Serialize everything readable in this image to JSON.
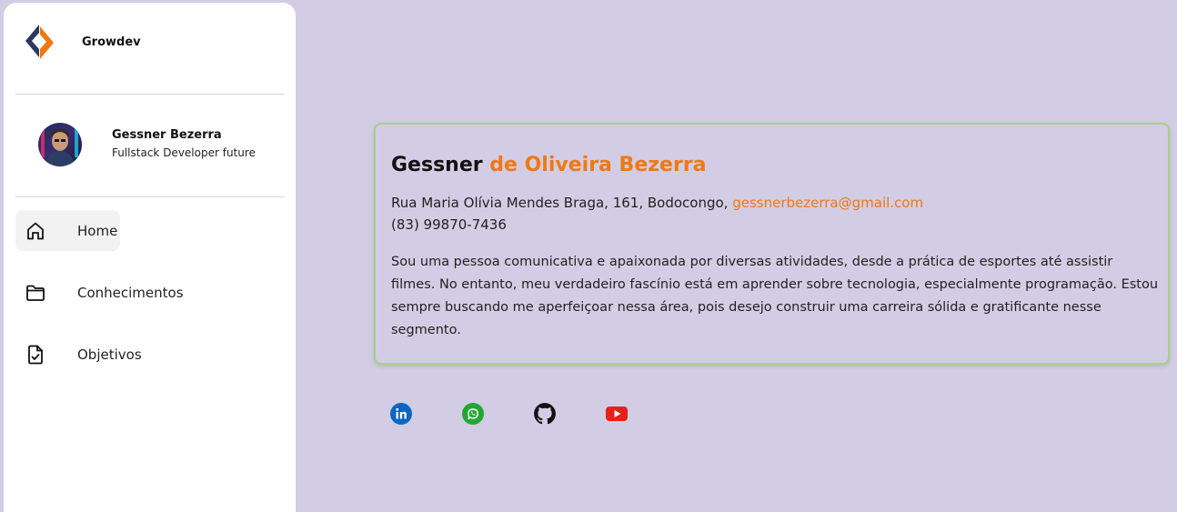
{
  "brand": {
    "name": "Growdev",
    "logo_icon": "growdev-logo-icon"
  },
  "profile": {
    "name": "Gessner Bezerra",
    "role": "Fullstack Developer future",
    "avatar_icon": "avatar-photo"
  },
  "nav": [
    {
      "label": "Home",
      "icon": "home-icon",
      "active": true
    },
    {
      "label": "Conhecimentos",
      "icon": "folder-icon",
      "active": false
    },
    {
      "label": "Objetivos",
      "icon": "file-check-icon",
      "active": false
    }
  ],
  "card": {
    "first_name": "Gessner",
    "last_name": "de Oliveira Bezerra",
    "address": "Rua Maria Olívia Mendes Braga, 161, Bodocongo,",
    "email": "gessnerbezerra@gmail.com",
    "phone": "(83) 99870-7436",
    "bio": "Sou uma pessoa comunicativa e apaixonada por diversas atividades, desde a prática de esportes até assistir filmes. No entanto, meu verdadeiro fascínio está em aprender sobre tecnologia, especialmente programação. Estou sempre buscando me aperfeiçoar nessa área, pois desejo construir uma carreira sólida e gratificante nesse segmento."
  },
  "socials": [
    {
      "icon": "linkedin-icon",
      "color": "#0a66c2"
    },
    {
      "icon": "whatsapp-icon",
      "color": "#25a532"
    },
    {
      "icon": "github-icon",
      "color": "#111111"
    },
    {
      "icon": "youtube-icon",
      "color": "#e62117"
    }
  ],
  "colors": {
    "background": "#d2cde4",
    "accent": "#f07814",
    "card_border": "#a8cf8a",
    "sidebar": "#ffffff"
  }
}
